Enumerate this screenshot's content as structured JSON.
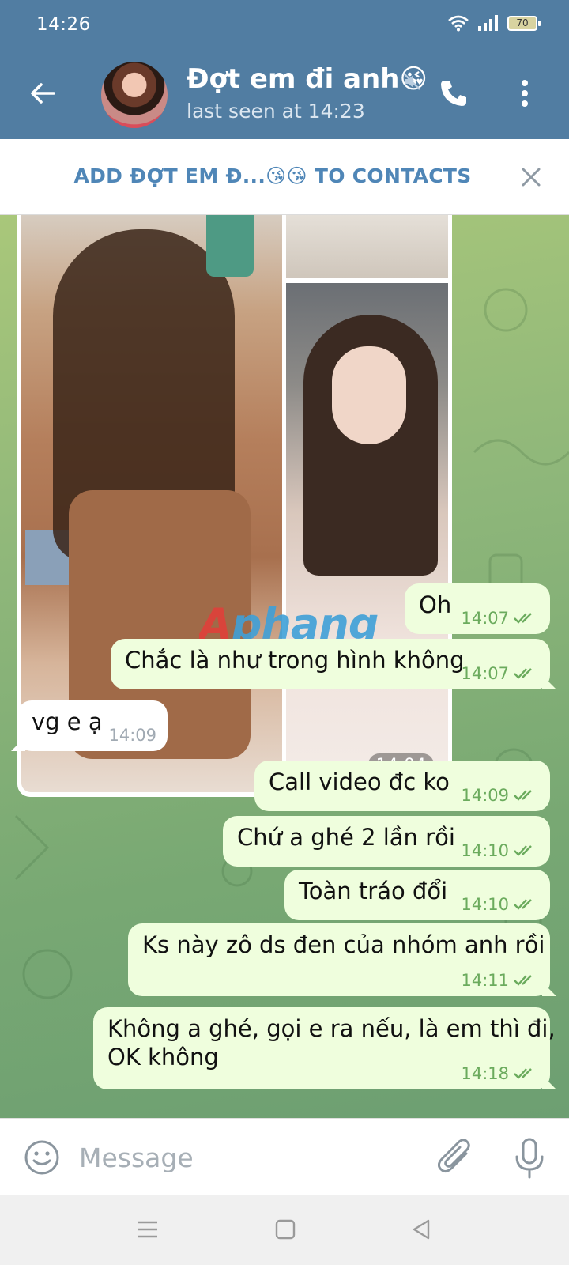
{
  "status_bar": {
    "time": "14:26",
    "battery": "70"
  },
  "header": {
    "chat_name": "Đợt em đi anh😘",
    "last_seen": "last seen at 14:23"
  },
  "add_contact_bar": {
    "label": "ADD ĐỢT EM Đ...😘😘 TO CONTACTS"
  },
  "album": {
    "time": "14:04"
  },
  "watermark": "Aphang",
  "messages": [
    {
      "dir": "out",
      "text": "Oh",
      "time": "14:07"
    },
    {
      "dir": "out",
      "text": "Chắc là như trong hình không",
      "time": "14:07"
    },
    {
      "dir": "in",
      "text": "vg e ạ",
      "time": "14:09"
    },
    {
      "dir": "out",
      "text": "Call video đc ko",
      "time": "14:09"
    },
    {
      "dir": "out",
      "text": "Chứ a ghé 2 lần rồi",
      "time": "14:10"
    },
    {
      "dir": "out",
      "text": "Toàn tráo đổi",
      "time": "14:10"
    },
    {
      "dir": "out",
      "text": "Ks này zô ds đen của nhóm anh rồi",
      "time": "14:11"
    },
    {
      "dir": "out",
      "text_line1": "Không a ghé, gọi e ra nếu, là em thì đi,",
      "text_line2": "OK không",
      "time": "14:18"
    }
  ],
  "input": {
    "placeholder": "Message"
  },
  "colors": {
    "header": "#517da2",
    "accent": "#4f86b7",
    "out_bubble": "#effedd",
    "check": "#6bab5d"
  }
}
